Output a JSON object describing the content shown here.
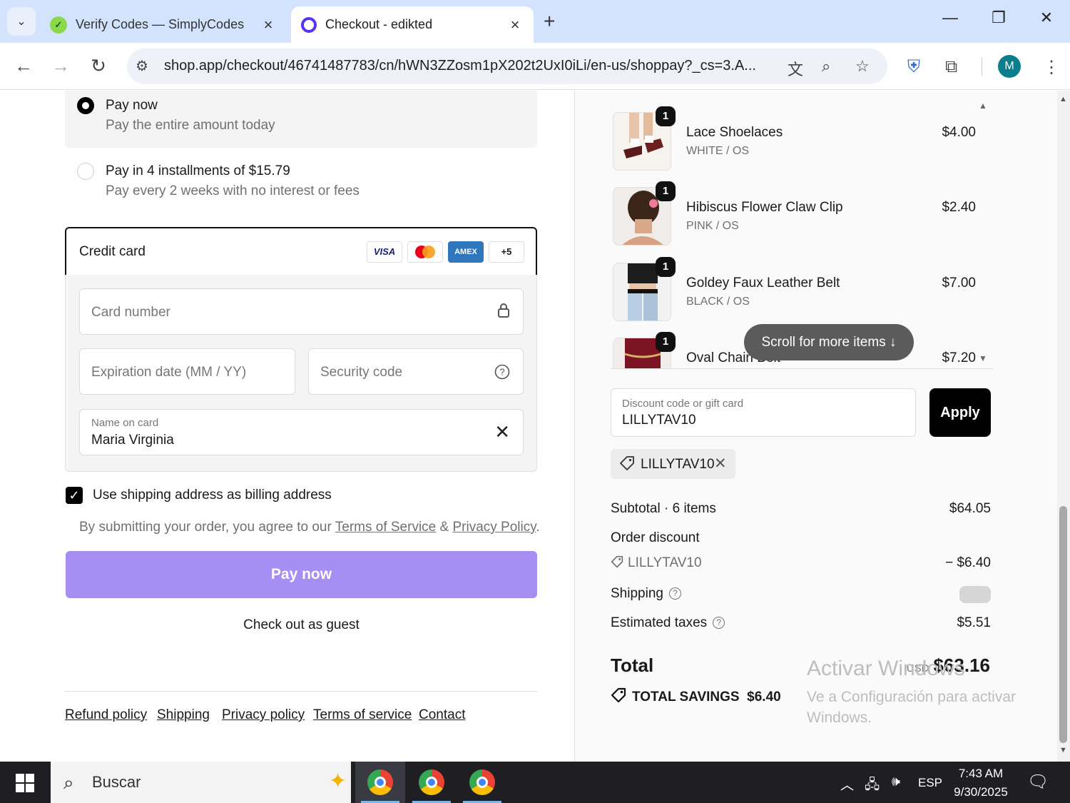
{
  "browser": {
    "tabs": [
      {
        "title": "Verify Codes — SimplyCodes",
        "active": false
      },
      {
        "title": "Checkout - edikted",
        "active": true
      }
    ],
    "url": "shop.app/checkout/46741487783/cn/hWN3ZZosm1pX202t2UxI0iLi/en-us/shoppay?_cs=3.A...",
    "profile_initial": "M"
  },
  "payment": {
    "pay_now": {
      "title": "Pay now",
      "subtitle": "Pay the entire amount today"
    },
    "installments": {
      "title": "Pay in 4 installments of $15.79",
      "subtitle": "Pay every 2 weeks with no interest or fees"
    },
    "credit_card": {
      "title": "Credit card",
      "brands": [
        "VISA",
        "",
        "AMEX",
        "+5"
      ],
      "card_number_placeholder": "Card number",
      "expiry_placeholder": "Expiration date (MM / YY)",
      "security_placeholder": "Security code",
      "name_label": "Name on card",
      "name_value": "Maria Virginia"
    },
    "billing_checkbox_label": "Use shipping address as billing address",
    "terms": {
      "prefix": "By submitting your order, you agree to our ",
      "tos": "Terms of Service",
      "amp": " & ",
      "privacy": "Privacy Policy",
      "suffix": "."
    },
    "pay_button": "Pay now",
    "guest_link": "Check out as guest"
  },
  "footer_links": [
    "Refund policy",
    "Shipping",
    "Privacy policy",
    "Terms of service",
    "Contact"
  ],
  "cart": {
    "items": [
      {
        "qty": "1",
        "name": "Lace Shoelaces",
        "variant": "WHITE / OS",
        "price": "$4.00"
      },
      {
        "qty": "1",
        "name": "Hibiscus Flower Claw Clip",
        "variant": "PINK / OS",
        "price": "$2.40"
      },
      {
        "qty": "1",
        "name": "Goldey Faux Leather Belt",
        "variant": "BLACK / OS",
        "price": "$7.00"
      },
      {
        "qty": "1",
        "name": "Oval Chain Belt",
        "variant": "",
        "price": "$7.20"
      }
    ],
    "scroll_hint": "Scroll for more items ↓",
    "discount_label": "Discount code or gift card",
    "discount_value": "LILLYTAV10",
    "apply_button": "Apply",
    "applied_code": "LILLYTAV10",
    "summary": {
      "subtotal_label": "Subtotal · 6 items",
      "subtotal_value": "$64.05",
      "order_discount_label": "Order discount",
      "discount_code": "LILLYTAV10",
      "discount_value": "− $6.40",
      "shipping_label": "Shipping",
      "taxes_label": "Estimated taxes",
      "taxes_value": "$5.51",
      "total_label": "Total",
      "currency": "USD",
      "total_value": "$63.16",
      "savings_label": "TOTAL SAVINGS",
      "savings_value": "$6.40"
    }
  },
  "watermark": {
    "title": "Activar Windows",
    "subtitle": "Ve a Configuración para activar Windows."
  },
  "taskbar": {
    "search_placeholder": "Buscar",
    "language": "ESP",
    "time": "7:43 AM",
    "date": "9/30/2025"
  }
}
